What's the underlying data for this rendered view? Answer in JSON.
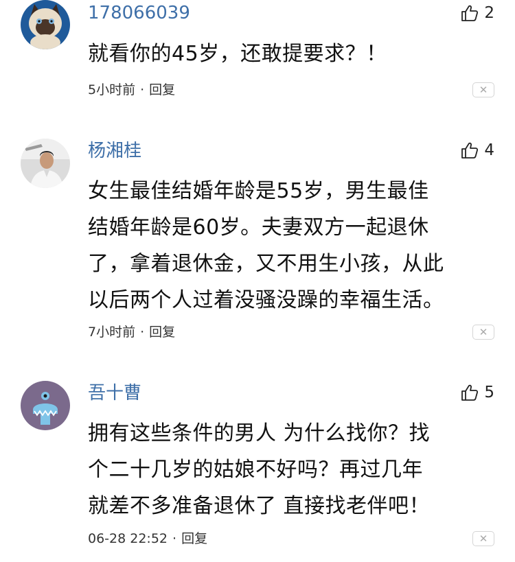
{
  "comments": [
    {
      "username": "178066039",
      "likes": "2",
      "content": "就看你的45岁，还敢提要求？！",
      "time": "5小时前",
      "reply_label": "回复",
      "close_symbol": "✕",
      "avatar_icon": "siamese-cat-avatar"
    },
    {
      "username": "杨湘桂",
      "likes": "4",
      "content": "女生最佳结婚年龄是55岁，男生最佳\n结婚年龄是60岁。夫妻双方一起退休\n了，拿着退休金，又不用生小孩，从此\n以后两个人过着没骚没躁的幸福生活。",
      "time": "7小时前",
      "reply_label": "回复",
      "close_symbol": "✕",
      "avatar_icon": "man-photo-avatar"
    },
    {
      "username": "吾十曹",
      "likes": "5",
      "content": "拥有这些条件的男人 为什么找你？找\n个二十几岁的姑娘不好吗？再过几年\n就差不多准备退休了 直接找老伴吧！",
      "time": "06-28 22:52",
      "reply_label": "回复",
      "close_symbol": "✕",
      "avatar_icon": "blue-monster-avatar"
    }
  ],
  "colors": {
    "username": "#3e6fa8",
    "avatar3_bg": "#7b6a8c"
  }
}
